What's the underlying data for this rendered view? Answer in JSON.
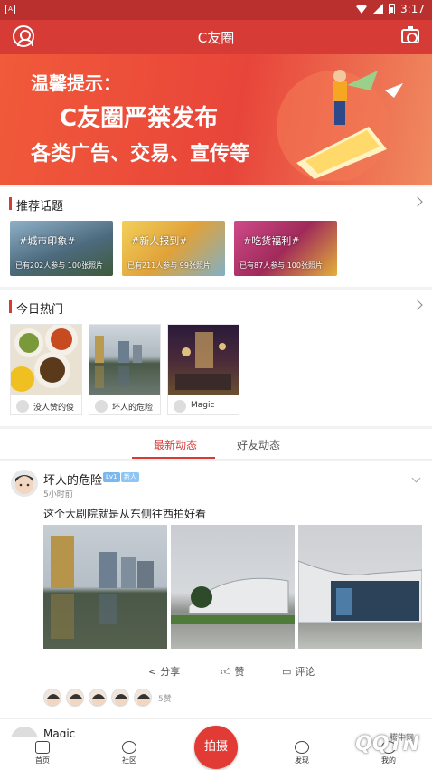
{
  "status_bar": {
    "time": "3:17"
  },
  "header": {
    "title": "C友圈"
  },
  "banner": {
    "line1": "温馨提示：",
    "line2": "C友圈严禁发布",
    "line3": "各类广告、交易、宣传等"
  },
  "topics_section": {
    "title": "推荐话题",
    "items": [
      {
        "tag": "#城市印象#",
        "stats": "已有202人参与   100张照片",
        "color": "#5a7a9a"
      },
      {
        "tag": "#新人报到#",
        "stats": "已有211人参与   99张照片",
        "color": "#e6b84c"
      },
      {
        "tag": "#吃货福利#",
        "stats": "已有87人参与   100张照片",
        "color": "#b63a6e"
      }
    ]
  },
  "hot_section": {
    "title": "今日热门",
    "items": [
      {
        "name": "没人赞的俊"
      },
      {
        "name": "坏人的危险"
      },
      {
        "name": "Magic"
      }
    ]
  },
  "feed_tabs": {
    "latest": "最新动态",
    "friends": "好友动态"
  },
  "post": {
    "username": "坏人的危险",
    "badge1": "Lv1",
    "badge2": "新人",
    "time": "5小时前",
    "content": "这个大剧院就是从东侧往西拍好看",
    "share": "分享",
    "like": "赞",
    "comment": "评论",
    "like_count": "5赞"
  },
  "next_post": {
    "username": "Magic"
  },
  "bottom_nav": {
    "home": "首页",
    "community": "社区",
    "shoot": "拍摄",
    "discover": "发现",
    "mine": "我的"
  },
  "watermark": {
    "brand": "QQTN",
    "small": "腾牛网"
  },
  "colors": {
    "primary": "#d63b36",
    "banner": "#ef5a3c"
  }
}
